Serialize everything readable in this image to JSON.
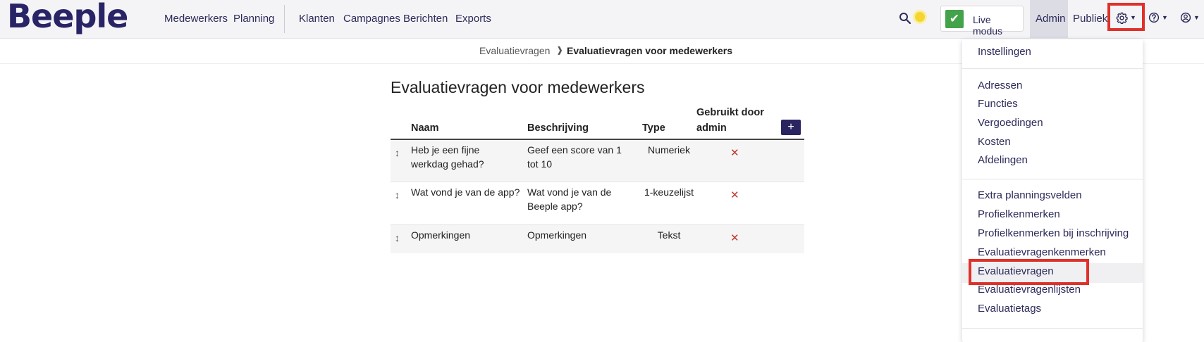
{
  "app": {
    "logo": "Beeple"
  },
  "nav": {
    "links": [
      "Medewerkers",
      "Planning",
      "Klanten",
      "Campagnes",
      "Berichten",
      "Exports"
    ],
    "live_mode_label": "Live modus",
    "admin_label": "Admin",
    "public_label": "Publiek"
  },
  "breadcrumb": {
    "parent": "Evaluatievragen",
    "separator": "❱",
    "current": "Evaluatievragen voor medewerkers"
  },
  "page": {
    "title": "Evaluatievragen voor medewerkers"
  },
  "table": {
    "headers": {
      "name": "Naam",
      "description": "Beschrijving",
      "type": "Type",
      "used_by_admin_line1": "Gebruikt door",
      "used_by_admin_line2": "admin"
    },
    "add_button": "+",
    "rows": [
      {
        "name": "Heb je een fijne werkdag gehad?",
        "description": "Geef een score van 1 tot 10",
        "type": "Numeriek",
        "used_by_admin": "✕"
      },
      {
        "name": "Wat vond je van de app?",
        "description": "Wat vond je van de Beeple app?",
        "type": "1-keuzelijst",
        "used_by_admin": "✕"
      },
      {
        "name": "Opmerkingen",
        "description": "Opmerkingen",
        "type": "Tekst",
        "used_by_admin": "✕"
      }
    ]
  },
  "settings_menu": {
    "groups": [
      [
        "Instellingen"
      ],
      [
        "Adressen",
        "Functies",
        "Vergoedingen",
        "Kosten",
        "Afdelingen"
      ],
      [
        "Extra planningsvelden",
        "Profielkenmerken",
        "Profielkenmerken bij inschrijving",
        "Evaluatievragenkenmerken",
        "Evaluatievragen",
        "Evaluatievragenlijsten",
        "Evaluatietags"
      ]
    ],
    "active_item": "Evaluatievragen"
  },
  "icons": {
    "search": "search-icon",
    "settings": "gear-icon",
    "help": "help-icon",
    "account": "user-icon",
    "drag": "drag-handle-icon",
    "check": "check-icon",
    "cross": "cross-icon"
  },
  "colors": {
    "brand": "#282466",
    "nav_bg": "#f4f4f6",
    "live_green": "#43a34a",
    "highlight_red": "#e0302a",
    "cross_red": "#c0392b"
  }
}
